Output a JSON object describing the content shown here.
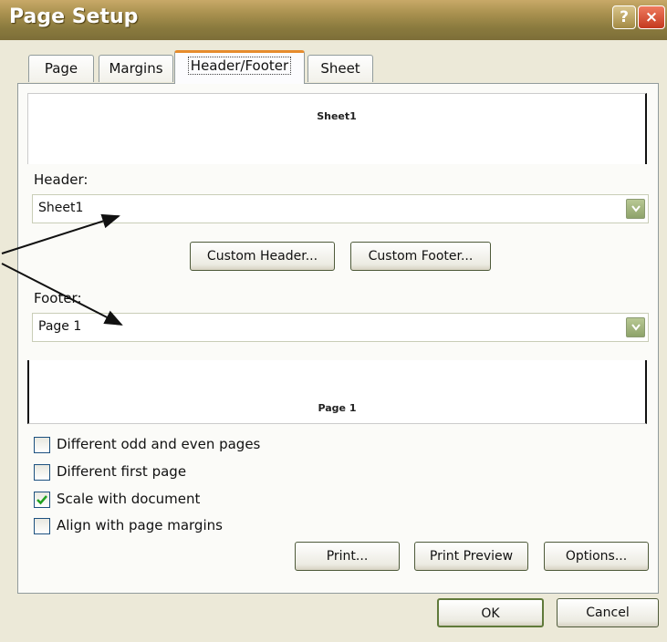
{
  "window": {
    "title": "Page Setup"
  },
  "titlebar": {
    "help_label": "?",
    "close_label": "×"
  },
  "tabs": [
    {
      "label": "Page"
    },
    {
      "label": "Margins"
    },
    {
      "label": "Header/Footer",
      "active": true
    },
    {
      "label": "Sheet"
    }
  ],
  "header_preview": {
    "text": "Sheet1"
  },
  "header": {
    "label": "Header:",
    "value": "Sheet1"
  },
  "custom_buttons": {
    "header": "Custom Header...",
    "footer": "Custom Footer..."
  },
  "footer": {
    "label": "Footer:",
    "value": "Page 1"
  },
  "footer_preview": {
    "text": "Page 1"
  },
  "options": [
    {
      "label": "Different odd and even pages",
      "checked": false
    },
    {
      "label": "Different first page",
      "checked": false
    },
    {
      "label": "Scale with document",
      "checked": true
    },
    {
      "label": "Align with page margins",
      "checked": false
    }
  ],
  "action_buttons": {
    "print": "Print...",
    "print_preview": "Print Preview",
    "options": "Options..."
  },
  "dialog_buttons": {
    "ok": "OK",
    "cancel": "Cancel"
  },
  "colors": {
    "titlebar": "#a8904e",
    "active_tab_accent": "#e68b2c",
    "dialog_bg": "#ECE9D8",
    "checkmark": "#21a121",
    "combo_button": "#8ea36a"
  },
  "icons": {
    "help": "help-icon",
    "close": "close-icon",
    "dropdown": "dropdown-arrow-icon",
    "checkmark": "checkmark-icon",
    "annotation": "annotation-arrow"
  }
}
